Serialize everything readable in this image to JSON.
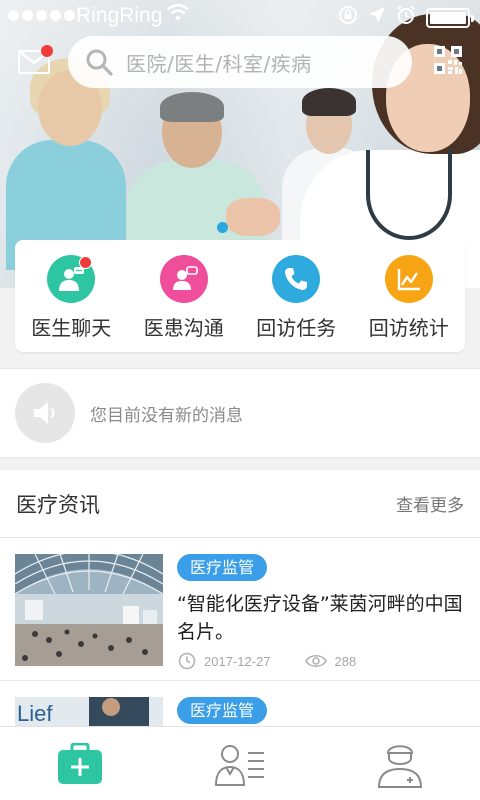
{
  "status_bar": {
    "carrier": "RingRing",
    "signal_icon": "signal-dots-icon",
    "wifi_icon": "wifi-icon",
    "orientation_lock_icon": "orientation-lock-icon",
    "location_icon": "location-arrow-icon",
    "alarm_icon": "alarm-clock-icon",
    "battery_level": 1.0
  },
  "header": {
    "mail_icon": "mail-icon",
    "mail_has_unread": true,
    "search_placeholder": "医院/医生/科室/疾病",
    "scan_icon": "qr-code-icon"
  },
  "banner": {
    "slide_count": 1,
    "active_slide": 1,
    "indicator_color": "#29a7e1"
  },
  "quick_menu": [
    {
      "label": "医生聊天",
      "icon": "doctor-chat-icon",
      "color": "#2dc5a2",
      "badge": true
    },
    {
      "label": "医患沟通",
      "icon": "patient-communication-icon",
      "color": "#ef4f9a",
      "badge": false
    },
    {
      "label": "回访任务",
      "icon": "phone-icon",
      "color": "#2eaadf",
      "badge": false
    },
    {
      "label": "回访统计",
      "icon": "chart-icon",
      "color": "#f7a415",
      "badge": false
    }
  ],
  "notice": {
    "icon": "speaker-icon",
    "text": "您目前没有新的消息"
  },
  "news": {
    "title": "医疗资讯",
    "more_label": "查看更多",
    "articles": [
      {
        "tag": "医疗监管",
        "title": "“智能化医疗设备”莱茵河畔的中国名片。",
        "date": "2017-12-27",
        "views": "288"
      },
      {
        "tag": "医疗监管",
        "thumb_text": "Lief"
      }
    ]
  },
  "tabbar": {
    "active_color": "#2dc5a2",
    "tabs": [
      {
        "name": "medical-kit-icon",
        "active": true
      },
      {
        "name": "patient-list-icon",
        "active": false
      },
      {
        "name": "doctor-profile-icon",
        "active": false
      }
    ]
  }
}
